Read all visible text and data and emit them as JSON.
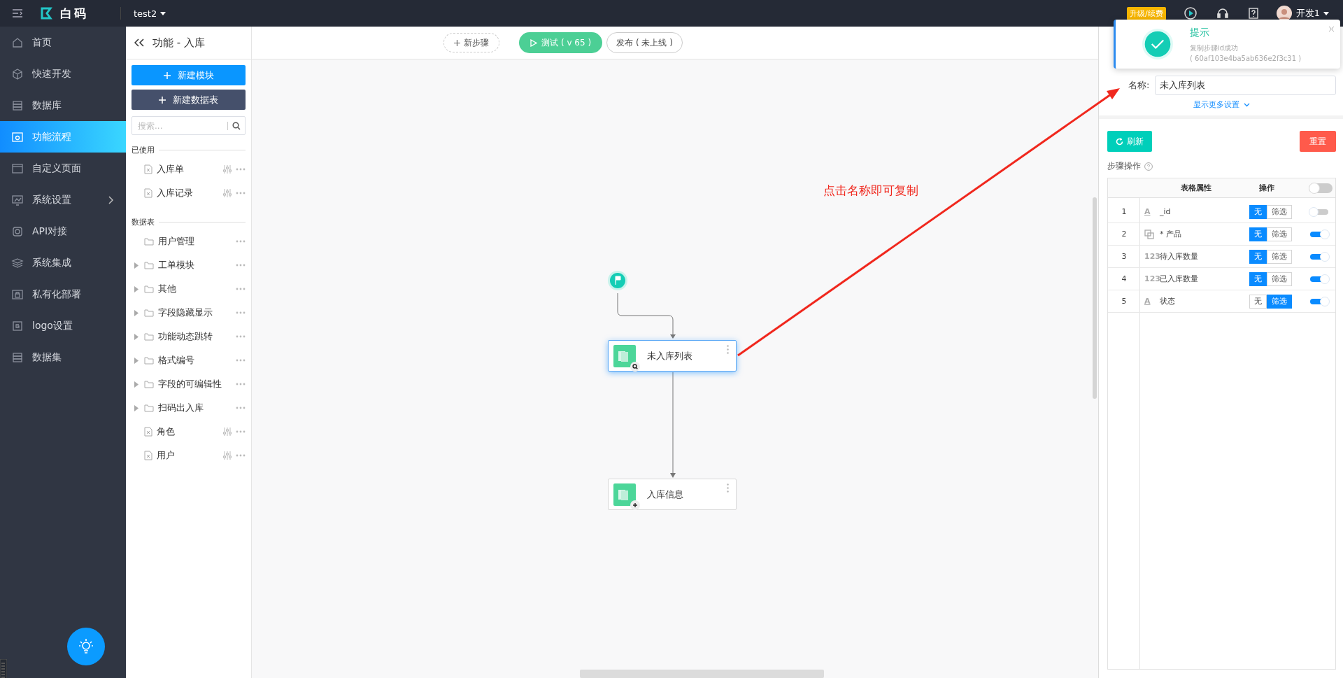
{
  "topbar": {
    "logo": "白码",
    "project": "test2",
    "upgrade_badge": "升级/续费",
    "user": "开发1"
  },
  "sidebar": {
    "items": [
      {
        "label": "首页",
        "selected": false,
        "has_submenu": false
      },
      {
        "label": "快速开发",
        "selected": false,
        "has_submenu": false
      },
      {
        "label": "数据库",
        "selected": false,
        "has_submenu": false
      },
      {
        "label": "功能流程",
        "selected": true,
        "has_submenu": false
      },
      {
        "label": "自定义页面",
        "selected": false,
        "has_submenu": false
      },
      {
        "label": "系统设置",
        "selected": false,
        "has_submenu": true
      },
      {
        "label": "API对接",
        "selected": false,
        "has_submenu": false
      },
      {
        "label": "系统集成",
        "selected": false,
        "has_submenu": false
      },
      {
        "label": "私有化部署",
        "selected": false,
        "has_submenu": false
      },
      {
        "label": "logo设置",
        "selected": false,
        "has_submenu": false
      },
      {
        "label": "数据集",
        "selected": false,
        "has_submenu": false
      }
    ]
  },
  "module_panel": {
    "title": "功能 - 入库",
    "buttons": [
      {
        "label": "新建模块",
        "kind": "primary"
      },
      {
        "label": "新建数据表",
        "kind": "dark"
      }
    ],
    "search": {
      "placeholder": "搜索..."
    },
    "sections": [
      {
        "title": "已使用",
        "items": [
          {
            "label": "入库单",
            "kind": "table"
          },
          {
            "label": "入库记录",
            "kind": "table"
          }
        ]
      },
      {
        "title": "数据表",
        "items": [
          {
            "label": "用户管理",
            "kind": "folder",
            "expandable": false
          },
          {
            "label": "工单模块",
            "kind": "folder",
            "expandable": true
          },
          {
            "label": "其他",
            "kind": "folder",
            "expandable": true
          },
          {
            "label": "字段隐藏显示",
            "kind": "folder",
            "expandable": true
          },
          {
            "label": "功能动态跳转",
            "kind": "folder",
            "expandable": true
          },
          {
            "label": "格式编号",
            "kind": "folder",
            "expandable": true
          },
          {
            "label": "字段的可编辑性",
            "kind": "folder",
            "expandable": true
          },
          {
            "label": "扫码出入库",
            "kind": "folder",
            "expandable": true
          },
          {
            "label": "角色",
            "kind": "table"
          },
          {
            "label": "用户",
            "kind": "table"
          }
        ]
      }
    ]
  },
  "toolbar": {
    "new_step": "新步骤",
    "test": "测试 ( v 65 )",
    "publish": "发布 ( 未上线 )"
  },
  "canvas": {
    "nodes": [
      {
        "label": "未入库列表",
        "kind": "search",
        "selected": true
      },
      {
        "label": "入库信息",
        "kind": "add",
        "selected": false
      }
    ],
    "annotation": "点击名称即可复制"
  },
  "toast": {
    "title": "提示",
    "message": "复制步骤id成功",
    "detail": "( 60af103e4ba5ab636e2f3c31 )"
  },
  "properties": {
    "name_label": "名称:",
    "name_value": "未入库列表",
    "more_settings": "显示更多设置",
    "refresh": "刷新",
    "reset": "重置",
    "section_title": "步骤操作",
    "table": {
      "columns": [
        "表格属性",
        "操作"
      ],
      "header_toggle_on": false,
      "rows": [
        {
          "index": "1",
          "kind": "text",
          "glyph": "A",
          "name": "_id",
          "options": [
            {
              "label": "无",
              "selected": true
            },
            {
              "label": "筛选",
              "selected": false
            }
          ],
          "on": false
        },
        {
          "index": "2",
          "kind": "relation",
          "name": "* 产品",
          "options": [
            {
              "label": "无",
              "selected": true
            },
            {
              "label": "筛选",
              "selected": false
            }
          ],
          "on": true
        },
        {
          "index": "3",
          "kind": "number",
          "glyph": "123",
          "name": "待入库数量",
          "options": [
            {
              "label": "无",
              "selected": true
            },
            {
              "label": "筛选",
              "selected": false
            }
          ],
          "on": true
        },
        {
          "index": "4",
          "kind": "number",
          "glyph": "123",
          "name": "已入库数量",
          "options": [
            {
              "label": "无",
              "selected": true
            },
            {
              "label": "筛选",
              "selected": false
            }
          ],
          "on": true
        },
        {
          "index": "5",
          "kind": "text",
          "glyph": "A",
          "name": "状态",
          "options": [
            {
              "label": "无",
              "selected": false
            },
            {
              "label": "筛选",
              "selected": true
            }
          ],
          "on": true
        }
      ]
    }
  }
}
